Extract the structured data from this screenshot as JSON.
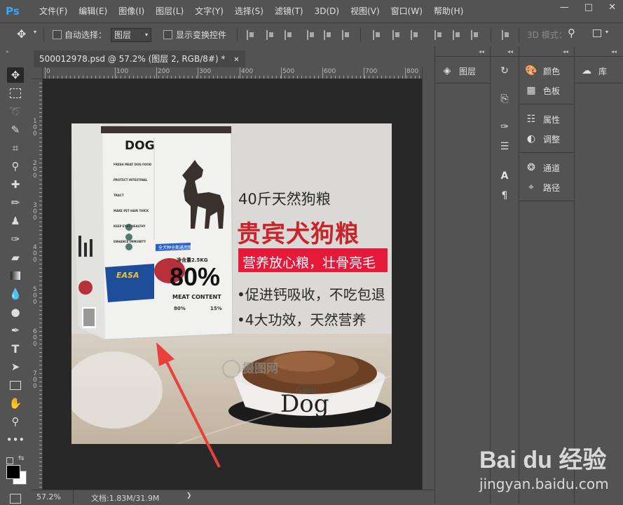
{
  "app": {
    "logo": "Ps"
  },
  "menu": [
    "文件(F)",
    "编辑(E)",
    "图像(I)",
    "图层(L)",
    "文字(Y)",
    "选择(S)",
    "滤镜(T)",
    "3D(D)",
    "视图(V)",
    "窗口(W)",
    "帮助(H)"
  ],
  "window_controls": [
    "—",
    "□",
    "✕"
  ],
  "options": {
    "auto_select_label": "自动选择：",
    "auto_select_value": "图层",
    "show_transform_label": "显示变换控件",
    "mode_3d_label": "3D 模式："
  },
  "document": {
    "tab_title": "500012978.psd @ 57.2% (图层 2, RGB/8#) *",
    "close": "✕"
  },
  "ruler": {
    "h_labels": [
      "0",
      "100",
      "200",
      "300",
      "400",
      "500",
      "600",
      "700",
      "800"
    ],
    "v_labels": [
      "1",
      "0",
      "0",
      "2",
      "0",
      "0",
      "3",
      "0",
      "0",
      "4",
      "0",
      "0",
      "5",
      "0",
      "0",
      "6",
      "0",
      "0",
      "7",
      "0",
      "0"
    ]
  },
  "status": {
    "zoom": "57.2%",
    "doc_info": "文档:1.83M/31.9M",
    "arrow": "❯"
  },
  "panels": {
    "layers": "图层",
    "color": "颜色",
    "swatches": "色板",
    "properties": "属性",
    "adjustments": "调整",
    "channels": "通道",
    "paths": "路径",
    "libraries": "库"
  },
  "artwork": {
    "bag_brand": "DOG",
    "bag_lines": [
      "FRESH MEAT DOG FOOD",
      "PROTECT INTESTINAL TRACT",
      "MAKE PET HAIR THICK",
      "KEEP EYES HEALTHY",
      "ENHANCE IMMUNITY"
    ],
    "bag_badge": "全犬种全期通用粮",
    "bag_weight": "净含量2.5KG",
    "bag_percent": "80%",
    "bag_meat": "MEAT CONTENT",
    "bag_logo": "EASA",
    "bag_foot_left": "80%",
    "bag_foot_right": "15%",
    "headline_small": "40斤天然狗粮",
    "headline_big": "贵宾犬狗粮",
    "red_banner": "营养放心粮，壮骨亮毛",
    "bullet1": "•促进钙吸收，不吃包退",
    "bullet2": "•4大功效，天然营养",
    "bowl_small": "Good",
    "bowl_big": "Dog",
    "watermark": "摄图网"
  },
  "baidu_watermark": {
    "logo": "Bai du 经验",
    "url": "jingyan.baidu.com"
  },
  "colors": {
    "accent": "#31a8ff",
    "red_banner": "#e5193a",
    "headline_red": "#c8242a",
    "arrow": "#e8413b"
  }
}
